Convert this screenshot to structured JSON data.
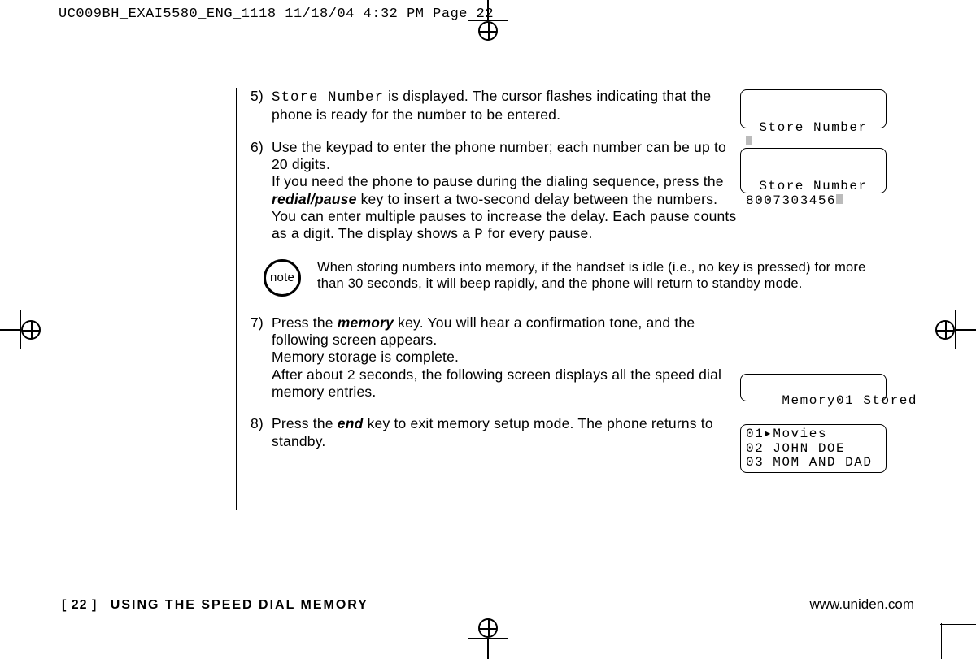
{
  "slug": "UC009BH_EXAI5580_ENG_1118  11/18/04  4:32 PM  Page 22",
  "steps": {
    "s5": {
      "num": "5)",
      "pre": "Store Number",
      "text": " is displayed. The cursor flashes indicating that the phone is ready for the number to be entered."
    },
    "s6": {
      "num": "6)",
      "p1": "Use the keypad to enter the phone number; each number can be up to 20 digits.",
      "p2a": "If you need the phone to pause during the dialing sequence, press the ",
      "key": "redial/pause",
      "p2b": " key to insert a two-second delay between the numbers. You can enter multiple pauses to increase the delay. Each pause counts as a digit. The display shows a ",
      "pchar": "P",
      "p2c": " for every pause."
    },
    "s7": {
      "num": "7)",
      "p1a": "Press the ",
      "key": "memory",
      "p1b": " key. You will hear a confirmation tone, and the following screen appears.",
      "p2": "Memory storage is complete.",
      "p3": "After about 2 seconds, the following screen displays all the speed dial memory entries."
    },
    "s8": {
      "num": "8)",
      "p1a": "Press the ",
      "key": "end",
      "p1b": " key to exit memory setup mode. The phone returns to standby."
    }
  },
  "note": {
    "label": "note",
    "text": "When storing numbers into memory, if the handset is idle (i.e., no key is pressed) for more than 30 seconds, it will beep rapidly, and the phone will return to standby mode."
  },
  "lcd": {
    "a_title": "Store Number",
    "b_title": "Store Number",
    "b_value": "8007303456",
    "c_value": "Memory01 Stored",
    "d_line1": "01▸Movies",
    "d_line2": "02 JOHN DOE",
    "d_line3": "03 MOM AND DAD"
  },
  "footer": {
    "page": "[ 22 ]",
    "section": "USING THE SPEED DIAL MEMORY",
    "url": "www.uniden.com"
  }
}
